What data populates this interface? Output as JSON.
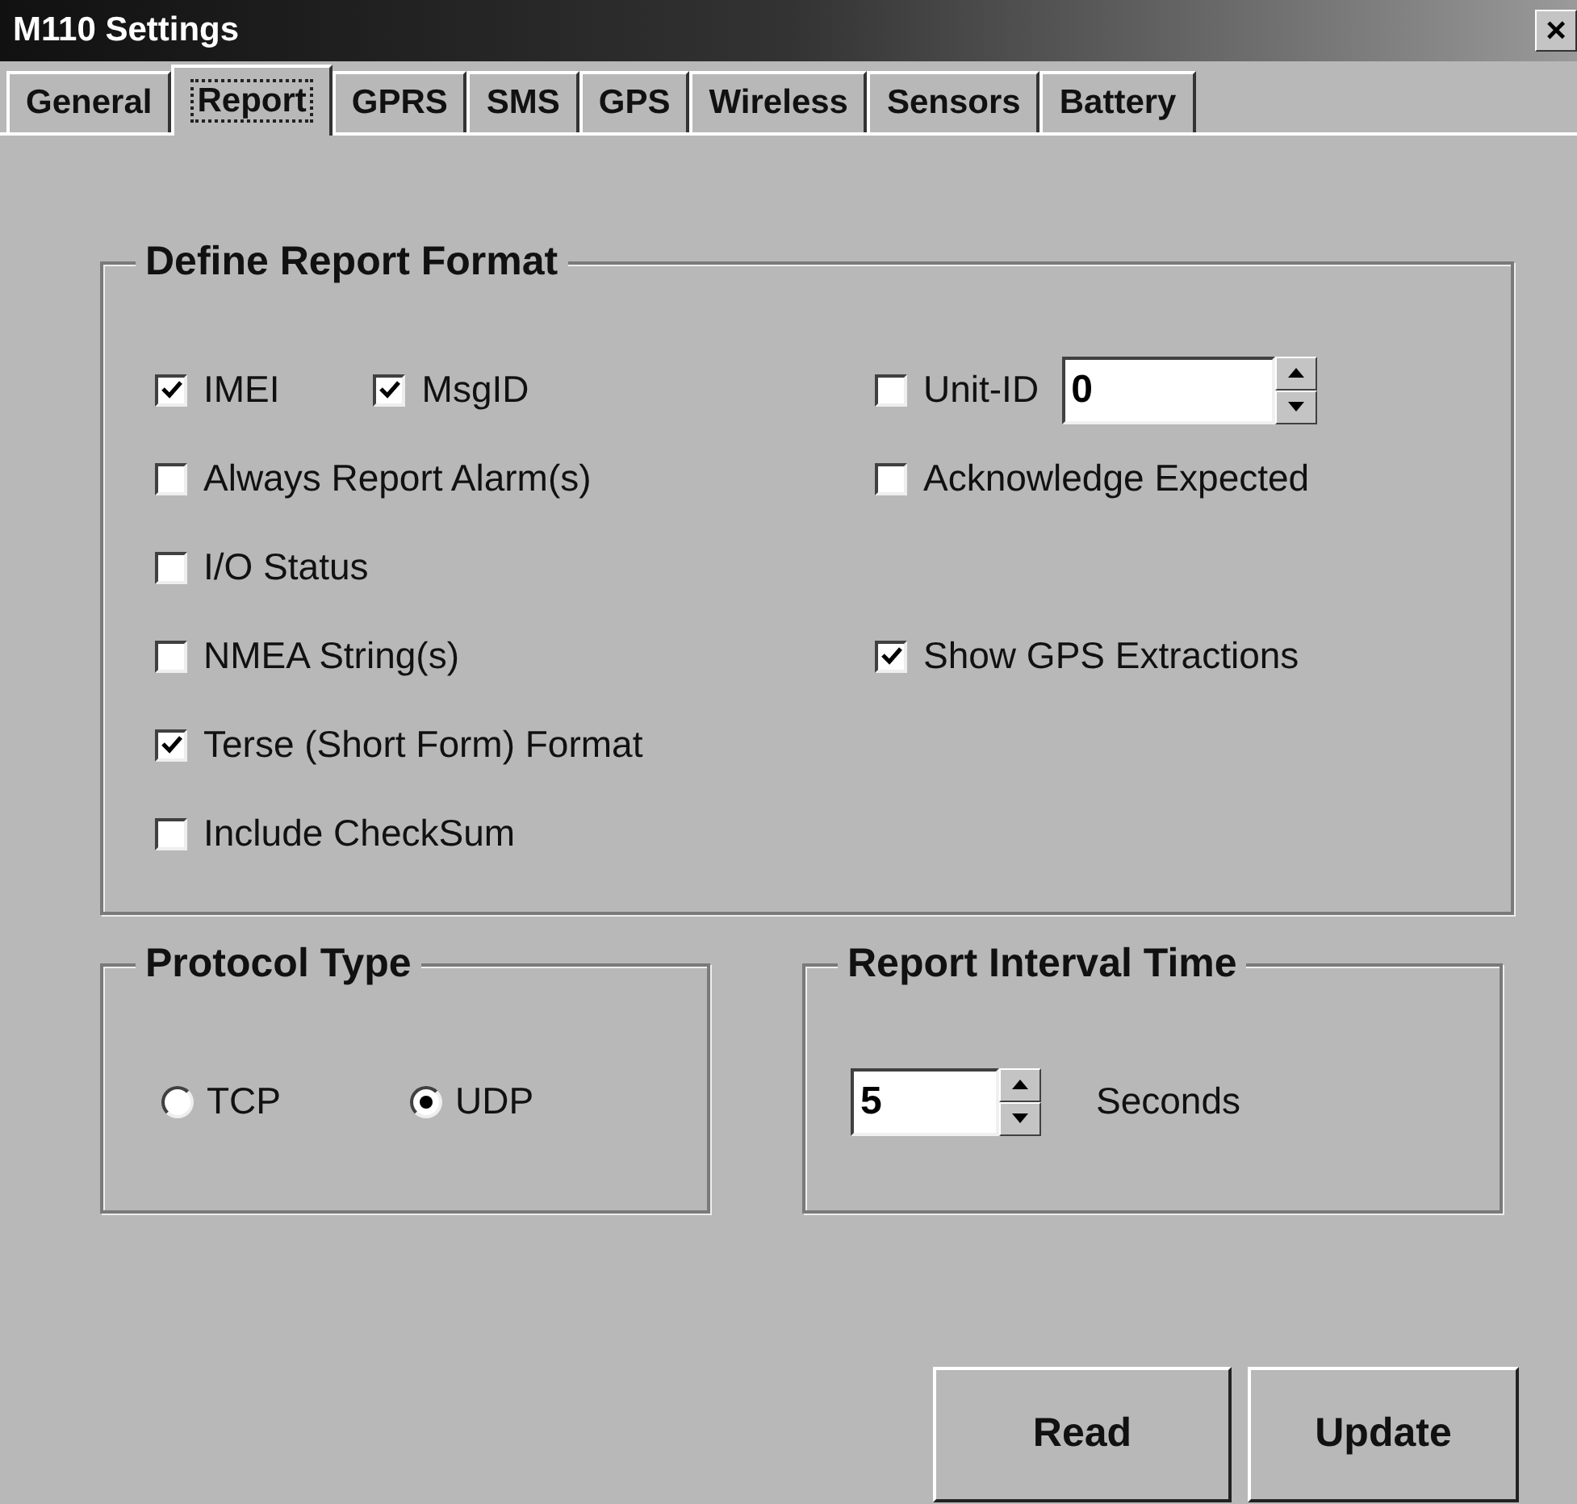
{
  "window": {
    "title": "M110 Settings",
    "close": "×"
  },
  "tabs": [
    {
      "label": "General",
      "selected": false
    },
    {
      "label": "Report",
      "selected": true
    },
    {
      "label": "GPRS",
      "selected": false
    },
    {
      "label": "SMS",
      "selected": false
    },
    {
      "label": "GPS",
      "selected": false
    },
    {
      "label": "Wireless",
      "selected": false
    },
    {
      "label": "Sensors",
      "selected": false
    },
    {
      "label": "Battery",
      "selected": false
    }
  ],
  "report_format": {
    "title": "Define Report Format",
    "rows": [
      {
        "left": [
          {
            "label": "IMEI",
            "checked": true
          },
          {
            "label": "MsgID",
            "checked": true
          }
        ],
        "right": [
          {
            "label": "Unit-ID",
            "checked": false,
            "value": "0"
          }
        ]
      },
      {
        "left": [
          {
            "label": "Always Report Alarm(s)",
            "checked": false
          }
        ],
        "right": [
          {
            "label": "Acknowledge Expected",
            "checked": false
          }
        ]
      },
      {
        "left": [
          {
            "label": "I/O Status",
            "checked": false
          }
        ],
        "right": []
      },
      {
        "left": [
          {
            "label": "NMEA String(s)",
            "checked": false
          }
        ],
        "right": [
          {
            "label": "Show GPS Extractions",
            "checked": true
          }
        ]
      },
      {
        "left": [
          {
            "label": "Terse (Short Form) Format",
            "checked": true
          }
        ],
        "right": []
      },
      {
        "left": [
          {
            "label": "Include CheckSum",
            "checked": false
          }
        ],
        "right": []
      }
    ]
  },
  "protocol_type": {
    "title": "Protocol Type",
    "options": [
      {
        "label": "TCP",
        "selected": false
      },
      {
        "label": "UDP",
        "selected": true
      }
    ]
  },
  "report_interval": {
    "title": "Report Interval Time",
    "value": "5",
    "unit": "Seconds"
  },
  "buttons": [
    "Read",
    "Update"
  ]
}
